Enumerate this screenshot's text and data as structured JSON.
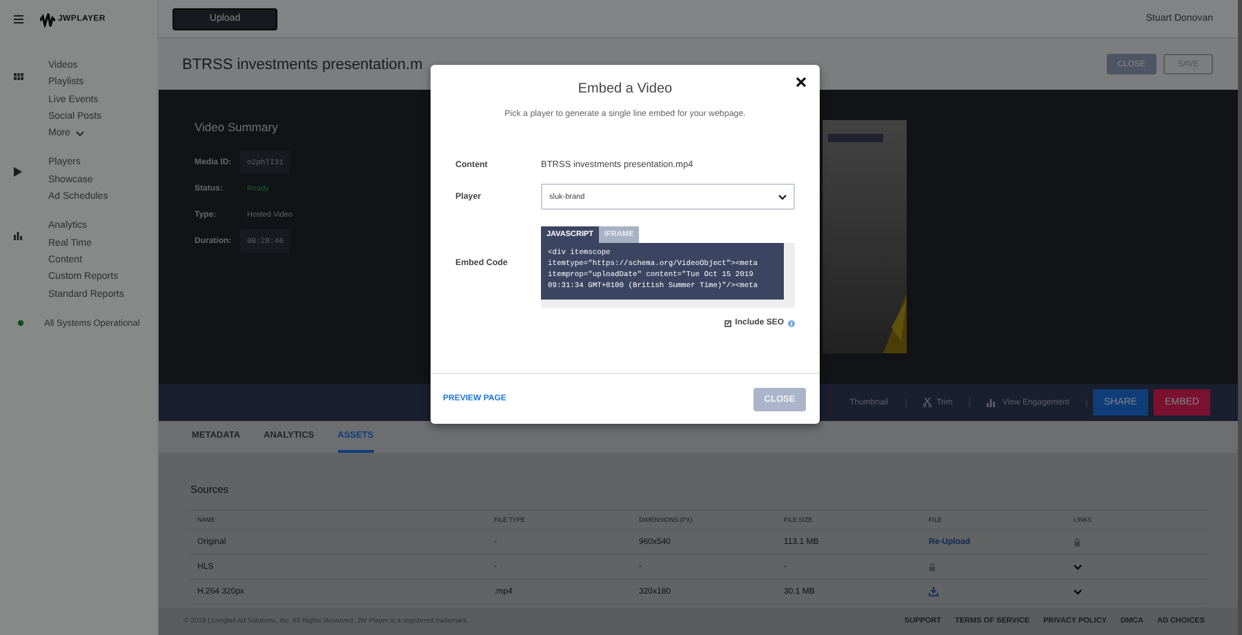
{
  "topbar": {
    "logo": "JWPLAYER",
    "upload_button": "Upload",
    "user": "Stuart Donovan"
  },
  "sidebar": {
    "sections": [
      {
        "kind": "videos",
        "items": [
          {
            "label": "Videos",
            "kind": "link"
          },
          {
            "label": "Playlists",
            "kind": "link"
          },
          {
            "label": "Live Events",
            "kind": "link"
          },
          {
            "label": "Social Posts",
            "kind": "link"
          },
          {
            "label": "More",
            "kind": "dropdown"
          }
        ]
      },
      {
        "kind": "players",
        "items": [
          {
            "label": "Players",
            "kind": "link"
          },
          {
            "label": "Showcase",
            "kind": "link"
          },
          {
            "label": "Ad Schedules",
            "kind": "link"
          }
        ]
      },
      {
        "kind": "analytics",
        "items": [
          {
            "label": "Analytics",
            "kind": "link"
          },
          {
            "label": "Real Time",
            "kind": "link"
          },
          {
            "label": "Content",
            "kind": "link"
          },
          {
            "label": "Custom Reports",
            "kind": "link"
          },
          {
            "label": "Standard Reports",
            "kind": "link"
          }
        ]
      }
    ],
    "status": "All Systems Operational"
  },
  "title": "BTRSS investments presentation.m",
  "header_buttons": [
    {
      "label": "CLOSE",
      "kind": "filled"
    },
    {
      "label": "SAVE",
      "kind": "outline"
    }
  ],
  "summary": {
    "title": "Video Summary",
    "fields": [
      {
        "label": "Media ID:",
        "value": "o2phTI31",
        "kind": "code"
      },
      {
        "label": "Status:",
        "value": "Ready",
        "kind": "status"
      },
      {
        "label": "Type:",
        "value": "Hosted Video",
        "kind": "plain"
      },
      {
        "label": "Duration:",
        "value": "00:28:46",
        "kind": "code"
      }
    ]
  },
  "actions": [
    {
      "label": "Thumbnail",
      "kind": "thumbnail"
    },
    {
      "label": "Trim",
      "kind": "trim"
    },
    {
      "label": "View Engagement",
      "kind": "engagement"
    },
    {
      "label": "SHARE",
      "kind": "share"
    },
    {
      "label": "EMBED",
      "kind": "embed"
    }
  ],
  "tabs": [
    {
      "label": "METADATA",
      "selected": false
    },
    {
      "label": "ANALYTICS",
      "selected": false
    },
    {
      "label": "ASSETS",
      "selected": true
    }
  ],
  "sources": {
    "title": "Sources",
    "columns": [
      "NAME",
      "FILE TYPE",
      "DIMENSIONS (PX)",
      "FILE SIZE",
      "FILE",
      "LINKS"
    ],
    "rows": [
      {
        "cells": [
          "Original",
          "-",
          "960x540",
          "113.1 MB"
        ],
        "file": {
          "kind": "link",
          "text": "Re-Upload"
        },
        "links": {
          "kind": "lock"
        }
      },
      {
        "cells": [
          "HLS",
          "-",
          "-",
          "-"
        ],
        "file": {
          "kind": "lock"
        },
        "links": {
          "kind": "chevron"
        }
      },
      {
        "cells": [
          "H.264 320px",
          ".mp4",
          "320x180",
          "30.1 MB"
        ],
        "file": {
          "kind": "download"
        },
        "links": {
          "kind": "chevron"
        }
      }
    ]
  },
  "footer": {
    "copyright": "© 2019 | Longtail Ad Solutions, Inc. All Rights Reserved. JW Player is a registered trademark.",
    "links": [
      "SUPPORT",
      "TERMS OF SERVICE",
      "PRIVACY POLICY",
      "DMCA",
      "AD CHOICES"
    ]
  },
  "modal": {
    "title": "Embed a Video",
    "subtitle": "Pick a player to generate a single line embed for your webpage.",
    "content_label": "Content",
    "content_value": "BTRSS investments presentation.mp4",
    "player_label": "Player",
    "player_value": "sluk-brand",
    "embed_label": "Embed Code",
    "code_tabs": [
      {
        "label": "JAVASCRIPT",
        "selected": true
      },
      {
        "label": "IFRAME",
        "selected": false
      }
    ],
    "code_lines": [
      "<div itemscope",
      "itemtype=\"https://schema.org/VideoObject\"><meta",
      "itemprop=\"uploadDate\" content=\"Tue Oct 15 2019",
      "09:31:34 GMT+0100 (British Summer Time)\"/><meta"
    ],
    "include_seo": {
      "label": "Include SEO",
      "checked": true
    },
    "preview_link": "PREVIEW PAGE",
    "close_button": "CLOSE"
  }
}
